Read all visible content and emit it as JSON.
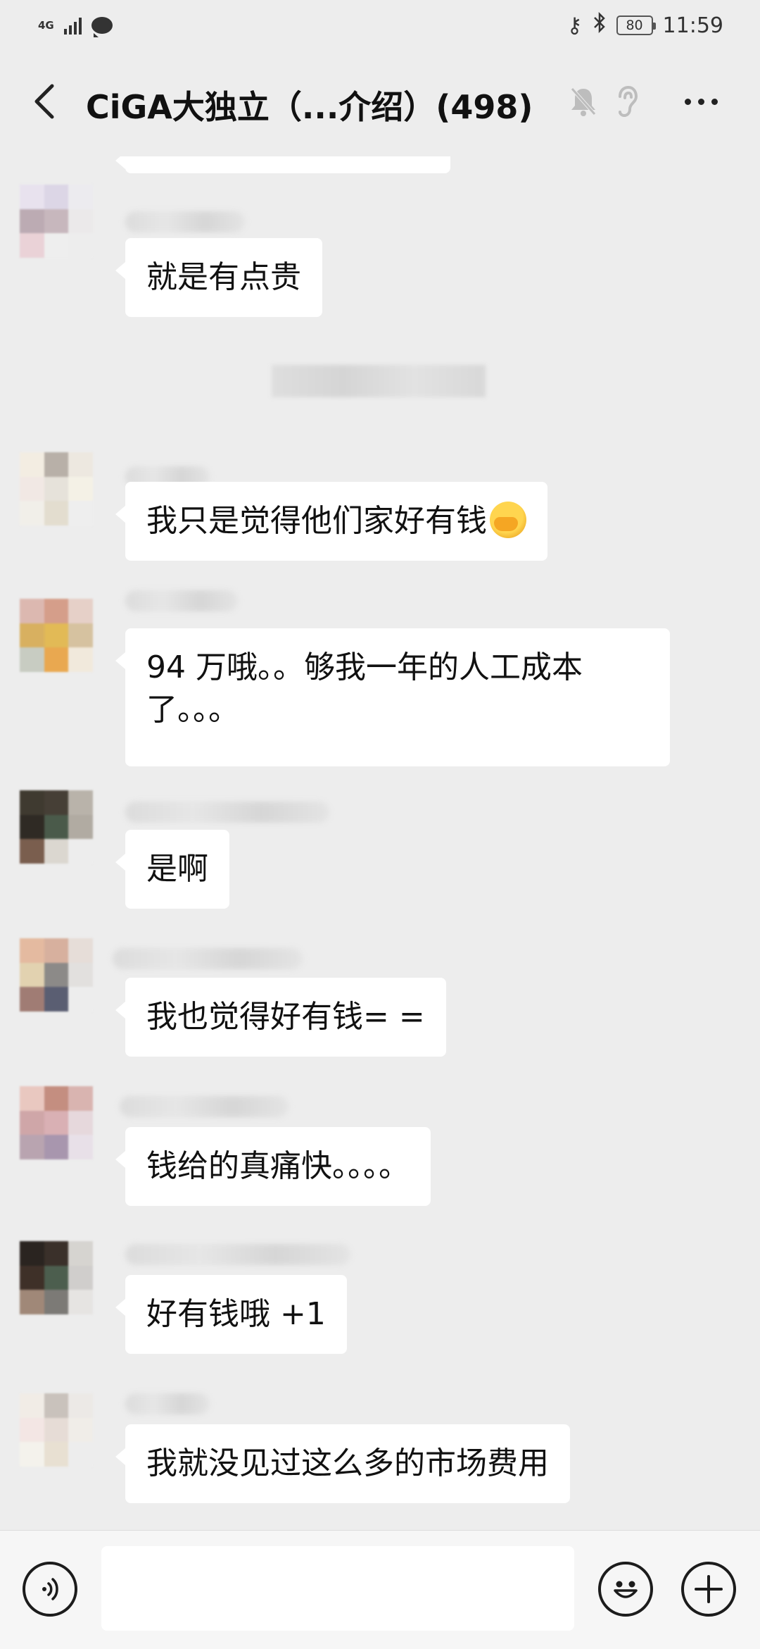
{
  "status_bar": {
    "network": "4G",
    "battery": "80",
    "time": "11:59",
    "icons": [
      "signal-icon",
      "message-icon",
      "key-icon",
      "bluetooth-icon",
      "battery-icon"
    ]
  },
  "header": {
    "back_icon": "chevron-left-icon",
    "title": "CiGA大独立（...介绍）(498)",
    "mute_icon": "bell-off-icon",
    "ear_icon": "ear-icon",
    "more_icon": "more-dots-icon"
  },
  "messages": [
    {
      "text": "就是有点贵"
    },
    {
      "text": "我只是觉得他们家好有钱"
    },
    {
      "text": "94 万哦。。够我一年的人工成本了。。。"
    },
    {
      "text": "是啊"
    },
    {
      "text": "我也觉得好有钱= ="
    },
    {
      "text": "钱给的真痛快。。。。"
    },
    {
      "text": "好有钱哦 +1"
    },
    {
      "text": "我就没见过这么多的市场费用"
    }
  ],
  "input_bar": {
    "voice_icon": "voice-icon",
    "input_placeholder": "",
    "emoji_icon": "emoji-icon",
    "plus_icon": "plus-icon"
  }
}
